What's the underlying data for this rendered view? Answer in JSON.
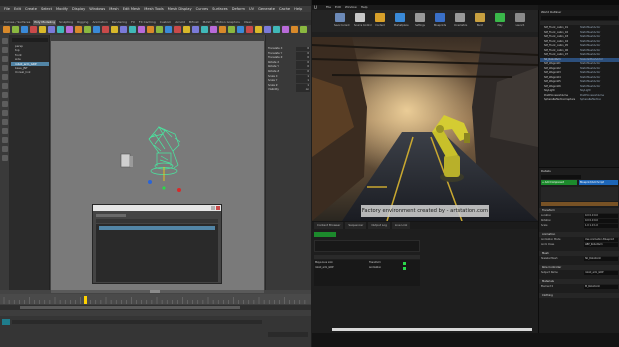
{
  "maya": {
    "menus": [
      "File",
      "Edit",
      "Create",
      "Select",
      "Modify",
      "Display",
      "Windows",
      "Mesh",
      "Edit Mesh",
      "Mesh Tools",
      "Mesh Display",
      "Curves",
      "Surfaces",
      "Deform",
      "UV",
      "Generate",
      "Cache",
      "Help"
    ],
    "shelf_tabs": [
      "Curves / Surfaces",
      "Poly Modeling",
      "Sculpting",
      "Rigging",
      "Animation",
      "Rendering",
      "FX",
      "FX Caching",
      "Custom",
      "Arnold",
      "Bifrost",
      "MASH",
      "Motion Graphics",
      "XGen"
    ],
    "active_shelf_tab": "Poly Modeling",
    "outliner_rows": [
      "persp",
      "top",
      "front",
      "side",
      "robot_arm_GRP",
      "base_JNT",
      "Unreal_link"
    ],
    "outliner_selected": "robot_arm_GRP",
    "channels": [
      {
        "label": "Translate X",
        "value": "0"
      },
      {
        "label": "Translate Y",
        "value": "0"
      },
      {
        "label": "Translate Z",
        "value": "0"
      },
      {
        "label": "Rotate X",
        "value": "0"
      },
      {
        "label": "Rotate Y",
        "value": "0"
      },
      {
        "label": "Rotate Z",
        "value": "0"
      },
      {
        "label": "Scale X",
        "value": "1"
      },
      {
        "label": "Scale Y",
        "value": "1"
      },
      {
        "label": "Scale Z",
        "value": "1"
      },
      {
        "label": "Visibility",
        "value": "on"
      }
    ],
    "timeline_current_frame": "1"
  },
  "unreal": {
    "menus": [
      "File",
      "Edit",
      "Window",
      "Help"
    ],
    "toolbar": [
      "Save Current",
      "Source Control",
      "Content",
      "Marketplace",
      "Settings",
      "Blueprints",
      "Cinematics",
      "Build",
      "Play",
      "Launch"
    ],
    "credit_text": "Factory environment created by - artstation.com",
    "cb_tabs": [
      "Content Browser",
      "Sequencer",
      "Output Log",
      "Live Link"
    ],
    "live_link_rows": [
      {
        "name": "Maya Live Link",
        "role": "Transform",
        "ok": true
      },
      {
        "name": "robot_arm_GRP",
        "role": "Animation",
        "ok": true
      }
    ],
    "outliner_rows": [
      {
        "name": "SM_Truck_cabin_01",
        "type": "StaticMeshActor"
      },
      {
        "name": "SM_Truck_cabin_02",
        "type": "StaticMeshActor"
      },
      {
        "name": "SM_Truck_cabin_03",
        "type": "StaticMeshActor"
      },
      {
        "name": "SM_Truck_cabin_04",
        "type": "StaticMeshActor"
      },
      {
        "name": "SM_Truck_cabin_05",
        "type": "StaticMeshActor"
      },
      {
        "name": "SM_Truck_cabin_06",
        "type": "StaticMeshActor"
      },
      {
        "name": "SM_Truck_cabin_07",
        "type": "StaticMeshActor"
      },
      {
        "name": "SK_RobotArm",
        "type": "SkeletalMeshActor"
      },
      {
        "name": "SM_Wagon01",
        "type": "StaticMeshActor"
      },
      {
        "name": "SM_Wagon02",
        "type": "StaticMeshActor"
      },
      {
        "name": "SM_Wagon03",
        "type": "StaticMeshActor"
      },
      {
        "name": "SM_Wagon04",
        "type": "StaticMeshActor"
      },
      {
        "name": "SM_Wagon05",
        "type": "StaticMeshActor"
      },
      {
        "name": "SM_Wagon06",
        "type": "StaticMeshActor"
      },
      {
        "name": "SkyLight",
        "type": "SkyLight"
      },
      {
        "name": "PostProcessVolume",
        "type": "PostProcessVolume"
      },
      {
        "name": "SphereReflectionCapture",
        "type": "SphereReflection"
      }
    ],
    "outliner_selected": "SK_RobotArm",
    "details_sections": [
      "Transform",
      "Animation",
      "Mesh",
      "Role Controller",
      "Materials",
      "Clothing"
    ],
    "details_rows": [
      {
        "label": "Location",
        "value": "0.0  0.0  0.0"
      },
      {
        "label": "Rotation",
        "value": "0.0  0.0  0.0"
      },
      {
        "label": "Scale",
        "value": "1.0  1.0  1.0"
      },
      {
        "label": "Animation Mode",
        "value": "Use Animation Blueprint"
      },
      {
        "label": "Anim Class",
        "value": "ABP_RobotArm"
      },
      {
        "label": "Skeletal Mesh",
        "value": "SK_RobotArm"
      },
      {
        "label": "Subject Name",
        "value": "robot_arm_GRP"
      },
      {
        "label": "Element 0",
        "value": "M_RobotArm"
      }
    ],
    "add_component_label": "+ Add Component",
    "blueprint_label": "Blueprint/Add Script",
    "search_placeholder": "Search..."
  },
  "colors": {
    "maya_bg": "#444444",
    "maya_select": "#5285a6",
    "ue_bg": "#151515",
    "ue_select": "#2c4f7c",
    "ue_add_green": "#1c8a2c",
    "ue_blueprint_blue": "#1d66b8",
    "robot_wire": "#48e8a0",
    "robot_yellow": "#c8c02a"
  }
}
